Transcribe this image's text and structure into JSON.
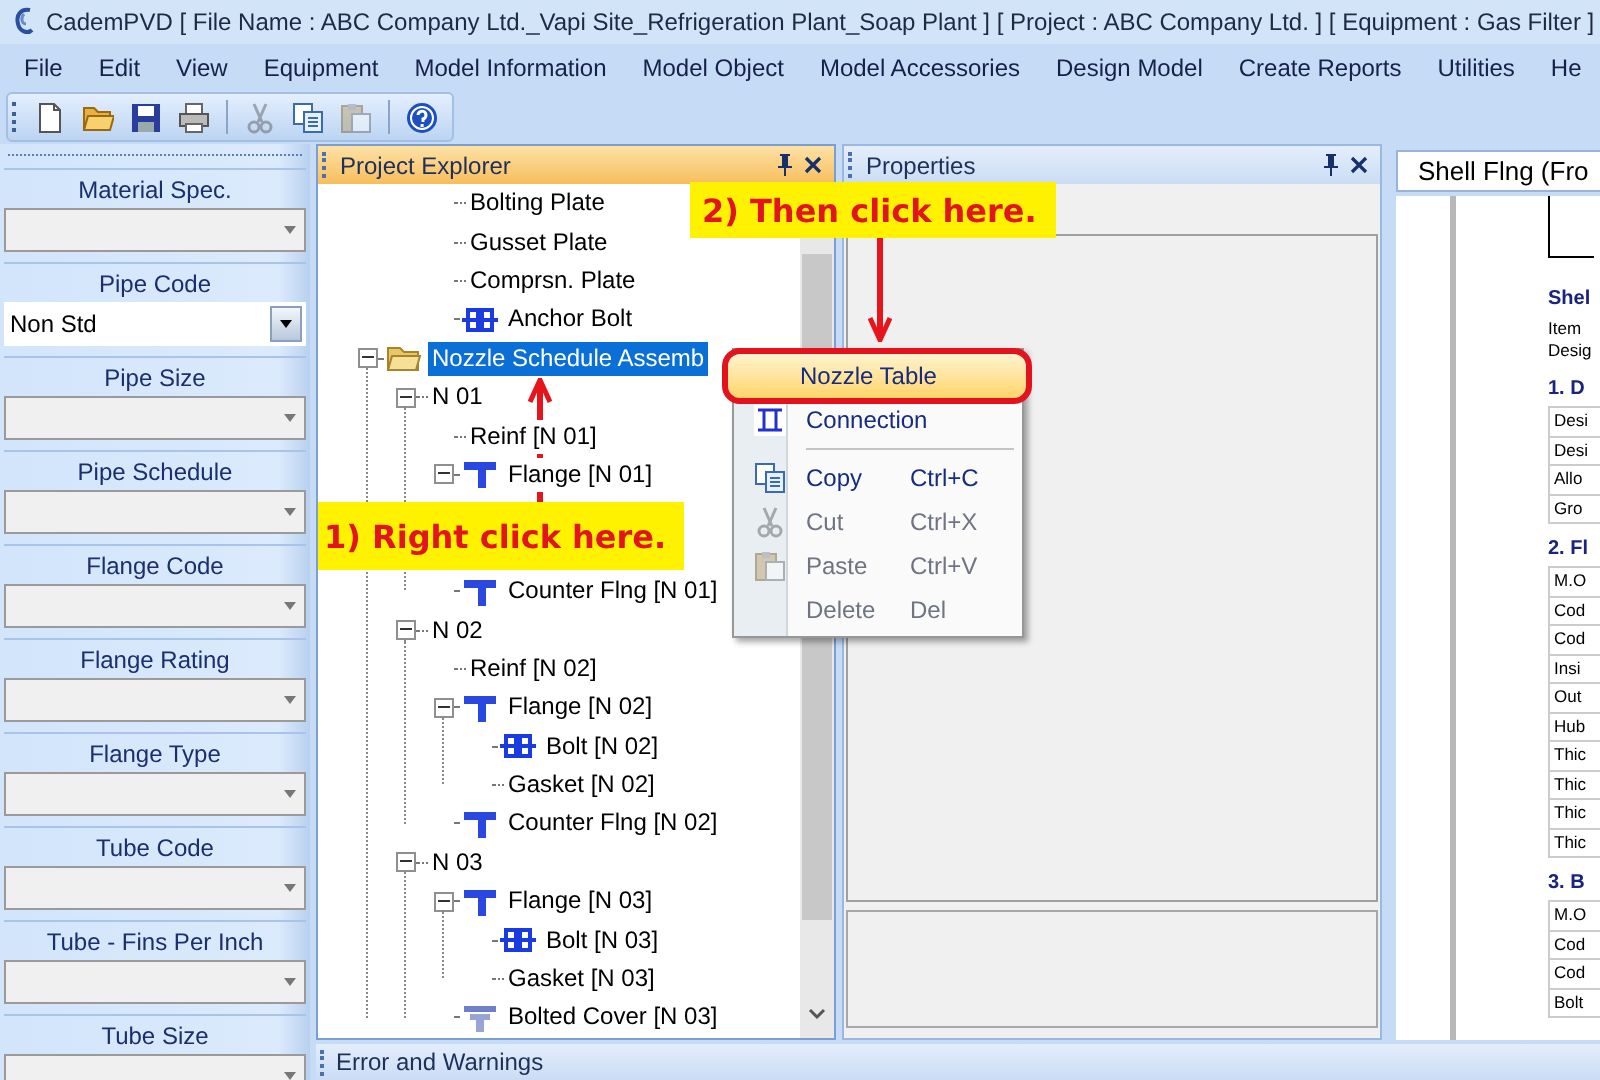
{
  "window": {
    "title": "CademPVD [ File Name : ABC Company Ltd._Vapi Site_Refrigeration Plant_Soap Plant ] [ Project : ABC Company Ltd. ] [ Equipment : Gas Filter ]"
  },
  "menu": [
    "File",
    "Edit",
    "View",
    "Equipment",
    "Model Information",
    "Model Object",
    "Model Accessories",
    "Design Model",
    "Create Reports",
    "Utilities",
    "He"
  ],
  "toolbar": [
    {
      "kind": "new",
      "disabled": false
    },
    {
      "kind": "open",
      "disabled": false
    },
    {
      "kind": "save",
      "disabled": false
    },
    {
      "kind": "print",
      "disabled": false
    },
    {
      "kind": "separator"
    },
    {
      "kind": "cut",
      "disabled": true
    },
    {
      "kind": "copy",
      "disabled": false
    },
    {
      "kind": "paste",
      "disabled": true
    },
    {
      "kind": "separator"
    },
    {
      "kind": "help",
      "disabled": false
    }
  ],
  "side_fields": [
    {
      "label": "Material Spec.",
      "disabled": true
    },
    {
      "label": "Pipe Code",
      "value": "Non Std",
      "disabled": false
    },
    {
      "label": "Pipe Size",
      "disabled": true
    },
    {
      "label": "Pipe Schedule",
      "disabled": true
    },
    {
      "label": "Flange Code",
      "disabled": true
    },
    {
      "label": "Flange Rating",
      "disabled": true
    },
    {
      "label": "Flange Type",
      "disabled": true
    },
    {
      "label": "Tube Code",
      "disabled": true
    },
    {
      "label": "Tube - Fins Per Inch",
      "disabled": true
    },
    {
      "label": "Tube Size",
      "disabled": true
    }
  ],
  "project_explorer": {
    "title": "Project Explorer",
    "active": true,
    "partial_branch": [
      {
        "kind": "plain",
        "label": "Bolting Plate",
        "selected": false
      },
      {
        "kind": "plain",
        "label": "Gusset Plate",
        "selected": false
      },
      {
        "kind": "plain",
        "label": "Comprsn. Plate",
        "selected": false
      },
      {
        "kind": "bolt",
        "label": "Anchor Bolt",
        "selected": false
      }
    ],
    "items": [
      {
        "kind": "folder",
        "label": "Nozzle Schedule Assemb",
        "expanded": true,
        "selected": true,
        "children": [
          {
            "kind": "plain",
            "label": "N 01",
            "expanded": true,
            "selected": false,
            "children": [
              {
                "kind": "plain",
                "label": "Reinf [N 01]",
                "selected": false
              },
              {
                "kind": "flange",
                "label": "Flange [N 01]",
                "expanded": true,
                "selected": false
              },
              {
                "kind": "callout",
                "text": "1) Right click here."
              },
              {
                "kind": "flange",
                "label": "Counter Flng [N 01]",
                "selected": false
              }
            ]
          },
          {
            "kind": "plain",
            "label": "N 02",
            "expanded": true,
            "selected": false,
            "children": [
              {
                "kind": "plain",
                "label": "Reinf [N 02]",
                "selected": false
              },
              {
                "kind": "flange",
                "label": "Flange [N 02]",
                "expanded": true,
                "selected": false,
                "children": [
                  {
                    "kind": "bolt",
                    "label": "Bolt [N 02]",
                    "selected": false
                  },
                  {
                    "kind": "plain",
                    "label": "Gasket [N 02]",
                    "selected": false
                  }
                ]
              },
              {
                "kind": "flange",
                "label": "Counter Flng [N 02]",
                "selected": false
              }
            ]
          },
          {
            "kind": "plain",
            "label": "N 03",
            "expanded": true,
            "selected": false,
            "children": [
              {
                "kind": "flange",
                "label": "Flange [N 03]",
                "expanded": true,
                "selected": false,
                "children": [
                  {
                    "kind": "bolt",
                    "label": "Bolt [N 03]",
                    "selected": false
                  },
                  {
                    "kind": "plain",
                    "label": "Gasket [N 03]",
                    "selected": false
                  }
                ]
              },
              {
                "kind": "cover",
                "label": "Bolted Cover [N 03]",
                "selected": false
              }
            ]
          }
        ]
      }
    ]
  },
  "properties": {
    "title": "Properties",
    "active": false
  },
  "document": {
    "tab": "Shell Flng (Fro",
    "lines": [
      {
        "kind": "heading",
        "text": "Shel"
      },
      {
        "kind": "text",
        "text": "Item"
      },
      {
        "kind": "text",
        "text": "Desig"
      },
      {
        "kind": "section",
        "text": "1. D"
      },
      {
        "kind": "row",
        "text": "Desi"
      },
      {
        "kind": "row",
        "text": "Desi"
      },
      {
        "kind": "row",
        "text": "Allo"
      },
      {
        "kind": "row",
        "text": "Gro"
      },
      {
        "kind": "section",
        "text": "2. Fl"
      },
      {
        "kind": "row",
        "text": "M.O"
      },
      {
        "kind": "row",
        "text": "Cod"
      },
      {
        "kind": "row",
        "text": "Cod"
      },
      {
        "kind": "row",
        "text": "Insi"
      },
      {
        "kind": "row",
        "text": "Out"
      },
      {
        "kind": "row",
        "text": "Hub"
      },
      {
        "kind": "row",
        "text": "Thic"
      },
      {
        "kind": "row",
        "text": "Thic"
      },
      {
        "kind": "row",
        "text": "Thic"
      },
      {
        "kind": "row",
        "text": "Thic"
      },
      {
        "kind": "section",
        "text": "3. B"
      },
      {
        "kind": "row",
        "text": "M.O"
      },
      {
        "kind": "row",
        "text": "Cod"
      },
      {
        "kind": "row",
        "text": "Cod"
      },
      {
        "kind": "row",
        "text": "Bolt"
      }
    ]
  },
  "context_menu": {
    "items": [
      {
        "kind": "nozzle_table",
        "label": "Nozzle Table",
        "selected": true,
        "disabled": false
      },
      {
        "kind": "connection",
        "label": "Connection",
        "selected": false,
        "disabled": false
      },
      {
        "kind": "separator"
      },
      {
        "kind": "copy",
        "label": "Copy",
        "shortcut": "Ctrl+C",
        "selected": false,
        "disabled": false
      },
      {
        "kind": "cut",
        "label": "Cut",
        "shortcut": "Ctrl+X",
        "selected": false,
        "disabled": true
      },
      {
        "kind": "paste",
        "label": "Paste",
        "shortcut": "Ctrl+V",
        "selected": false,
        "disabled": true
      },
      {
        "kind": "delete",
        "label": "Delete",
        "shortcut": "Del",
        "selected": false,
        "disabled": true
      }
    ]
  },
  "callouts": [
    {
      "text": "2) Then click here."
    }
  ],
  "error_panel": {
    "title": "Error and Warnings"
  }
}
